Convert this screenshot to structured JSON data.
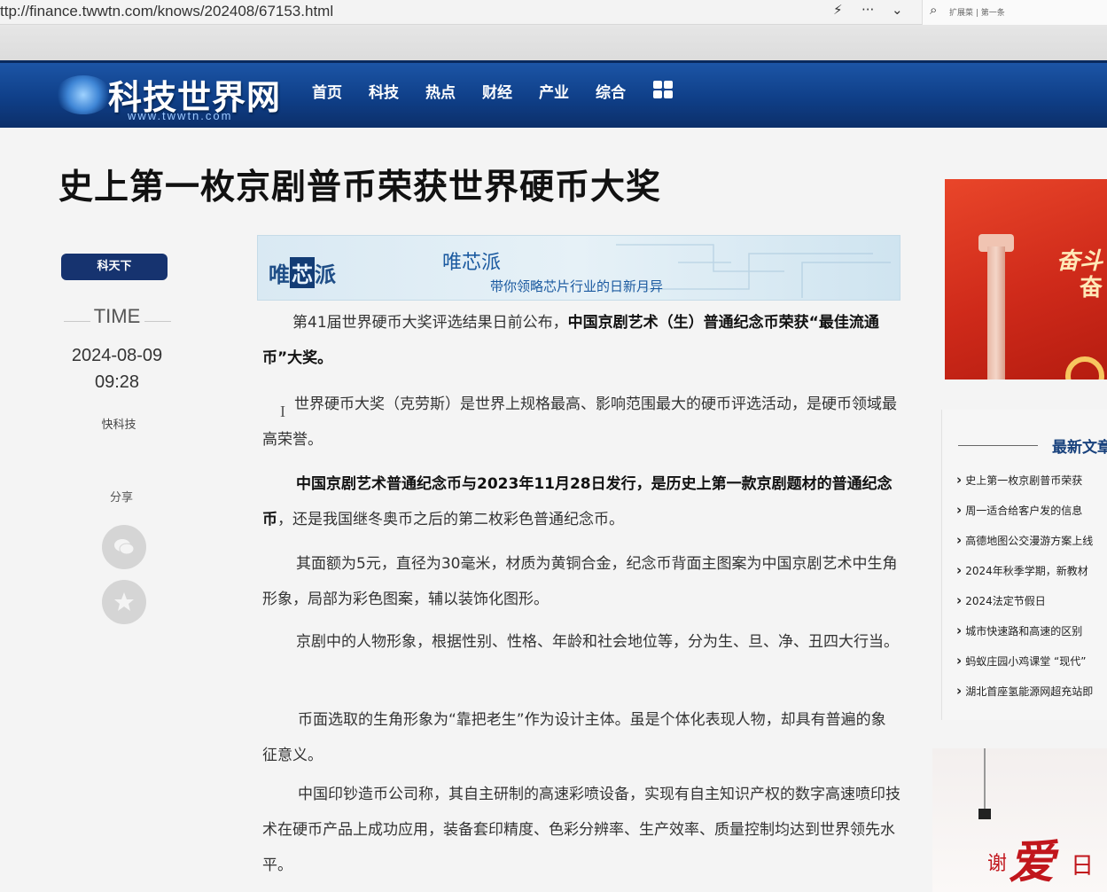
{
  "browser": {
    "url": "ttp://finance.twwtn.com/knows/202408/67153.html",
    "search_text": "扩展菜 | 第一条"
  },
  "header": {
    "logo": "科技世界网",
    "logo_sub": "www.twwtn.com",
    "nav": [
      "首页",
      "科技",
      "热点",
      "财经",
      "产业",
      "综合"
    ]
  },
  "article": {
    "title": "史上第一枚京剧普币荣获世界硬币大奖",
    "source_label": "科天下",
    "time_label": "TIME",
    "date": "2024-08-09",
    "time": "09:28",
    "author": "快科技",
    "share_label": "分享",
    "banner": {
      "logo_left": "唯",
      "logo_mid": "芯",
      "logo_right": "派",
      "title": "唯芯派",
      "subtitle": "带你领略芯片行业的日新月异"
    },
    "paragraphs": [
      {
        "plain1": "第41届世界硬币大奖评选结果日前公布，",
        "bold": "中国京剧艺术（生）普通纪念币荣获“最佳流通币”大奖。",
        "plain2": ""
      },
      {
        "plain1": "世界硬币大奖（克劳斯）是世界上规格最高、影响范围最大的硬币评选活动，是硬币领域最高荣誉。",
        "bold": "",
        "plain2": ""
      },
      {
        "plain1": "",
        "bold": "中国京剧艺术普通纪念币与2023年11月28日发行，是历史上第一款京剧题材的普通纪念币",
        "plain2": "，还是我国继冬奥币之后的第二枚彩色普通纪念币。"
      },
      {
        "plain1": "其面额为5元，直径为30毫米，材质为黄铜合金，纪念币背面主图案为中国京剧艺术中生角形象，局部为彩色图案，辅以装饰化图形。",
        "bold": "",
        "plain2": ""
      },
      {
        "plain1": "京剧中的人物形象，根据性别、性格、年龄和社会地位等，分为生、旦、净、丑四大行当。",
        "bold": "",
        "plain2": ""
      },
      {
        "plain1": "币面选取的生角形象为“靠把老生”作为设计主体。虽是个体化表现人物，却具有普遍的象征意义。",
        "bold": "",
        "plain2": ""
      },
      {
        "plain1": "中国印钞造币公司称，其自主研制的高速彩喷设备，实现有自主知识产权的数字高速喷印技术在硬币产品上成功应用，装备套印精度、色彩分辨率、生产效率、质量控制均达到世界领先水平。",
        "bold": "",
        "plain2": ""
      }
    ]
  },
  "sidebar": {
    "ad1_line1": "奋斗",
    "ad1_line2": "奋",
    "latest_title": "最新文章",
    "latest": [
      "史上第一枚京剧普币荣获",
      "周一适合给客户发的信息",
      "高德地图公交漫游方案上线",
      "2024年秋季学期，新教材",
      "2024法定节假日",
      "城市快速路和高速的区别",
      "蚂蚁庄园小鸡课堂 “现代”",
      "湖北首座氢能源网超充站即"
    ],
    "ad2_big": "爱",
    "ad2_small": "谢",
    "ad2_tiny": "日"
  }
}
